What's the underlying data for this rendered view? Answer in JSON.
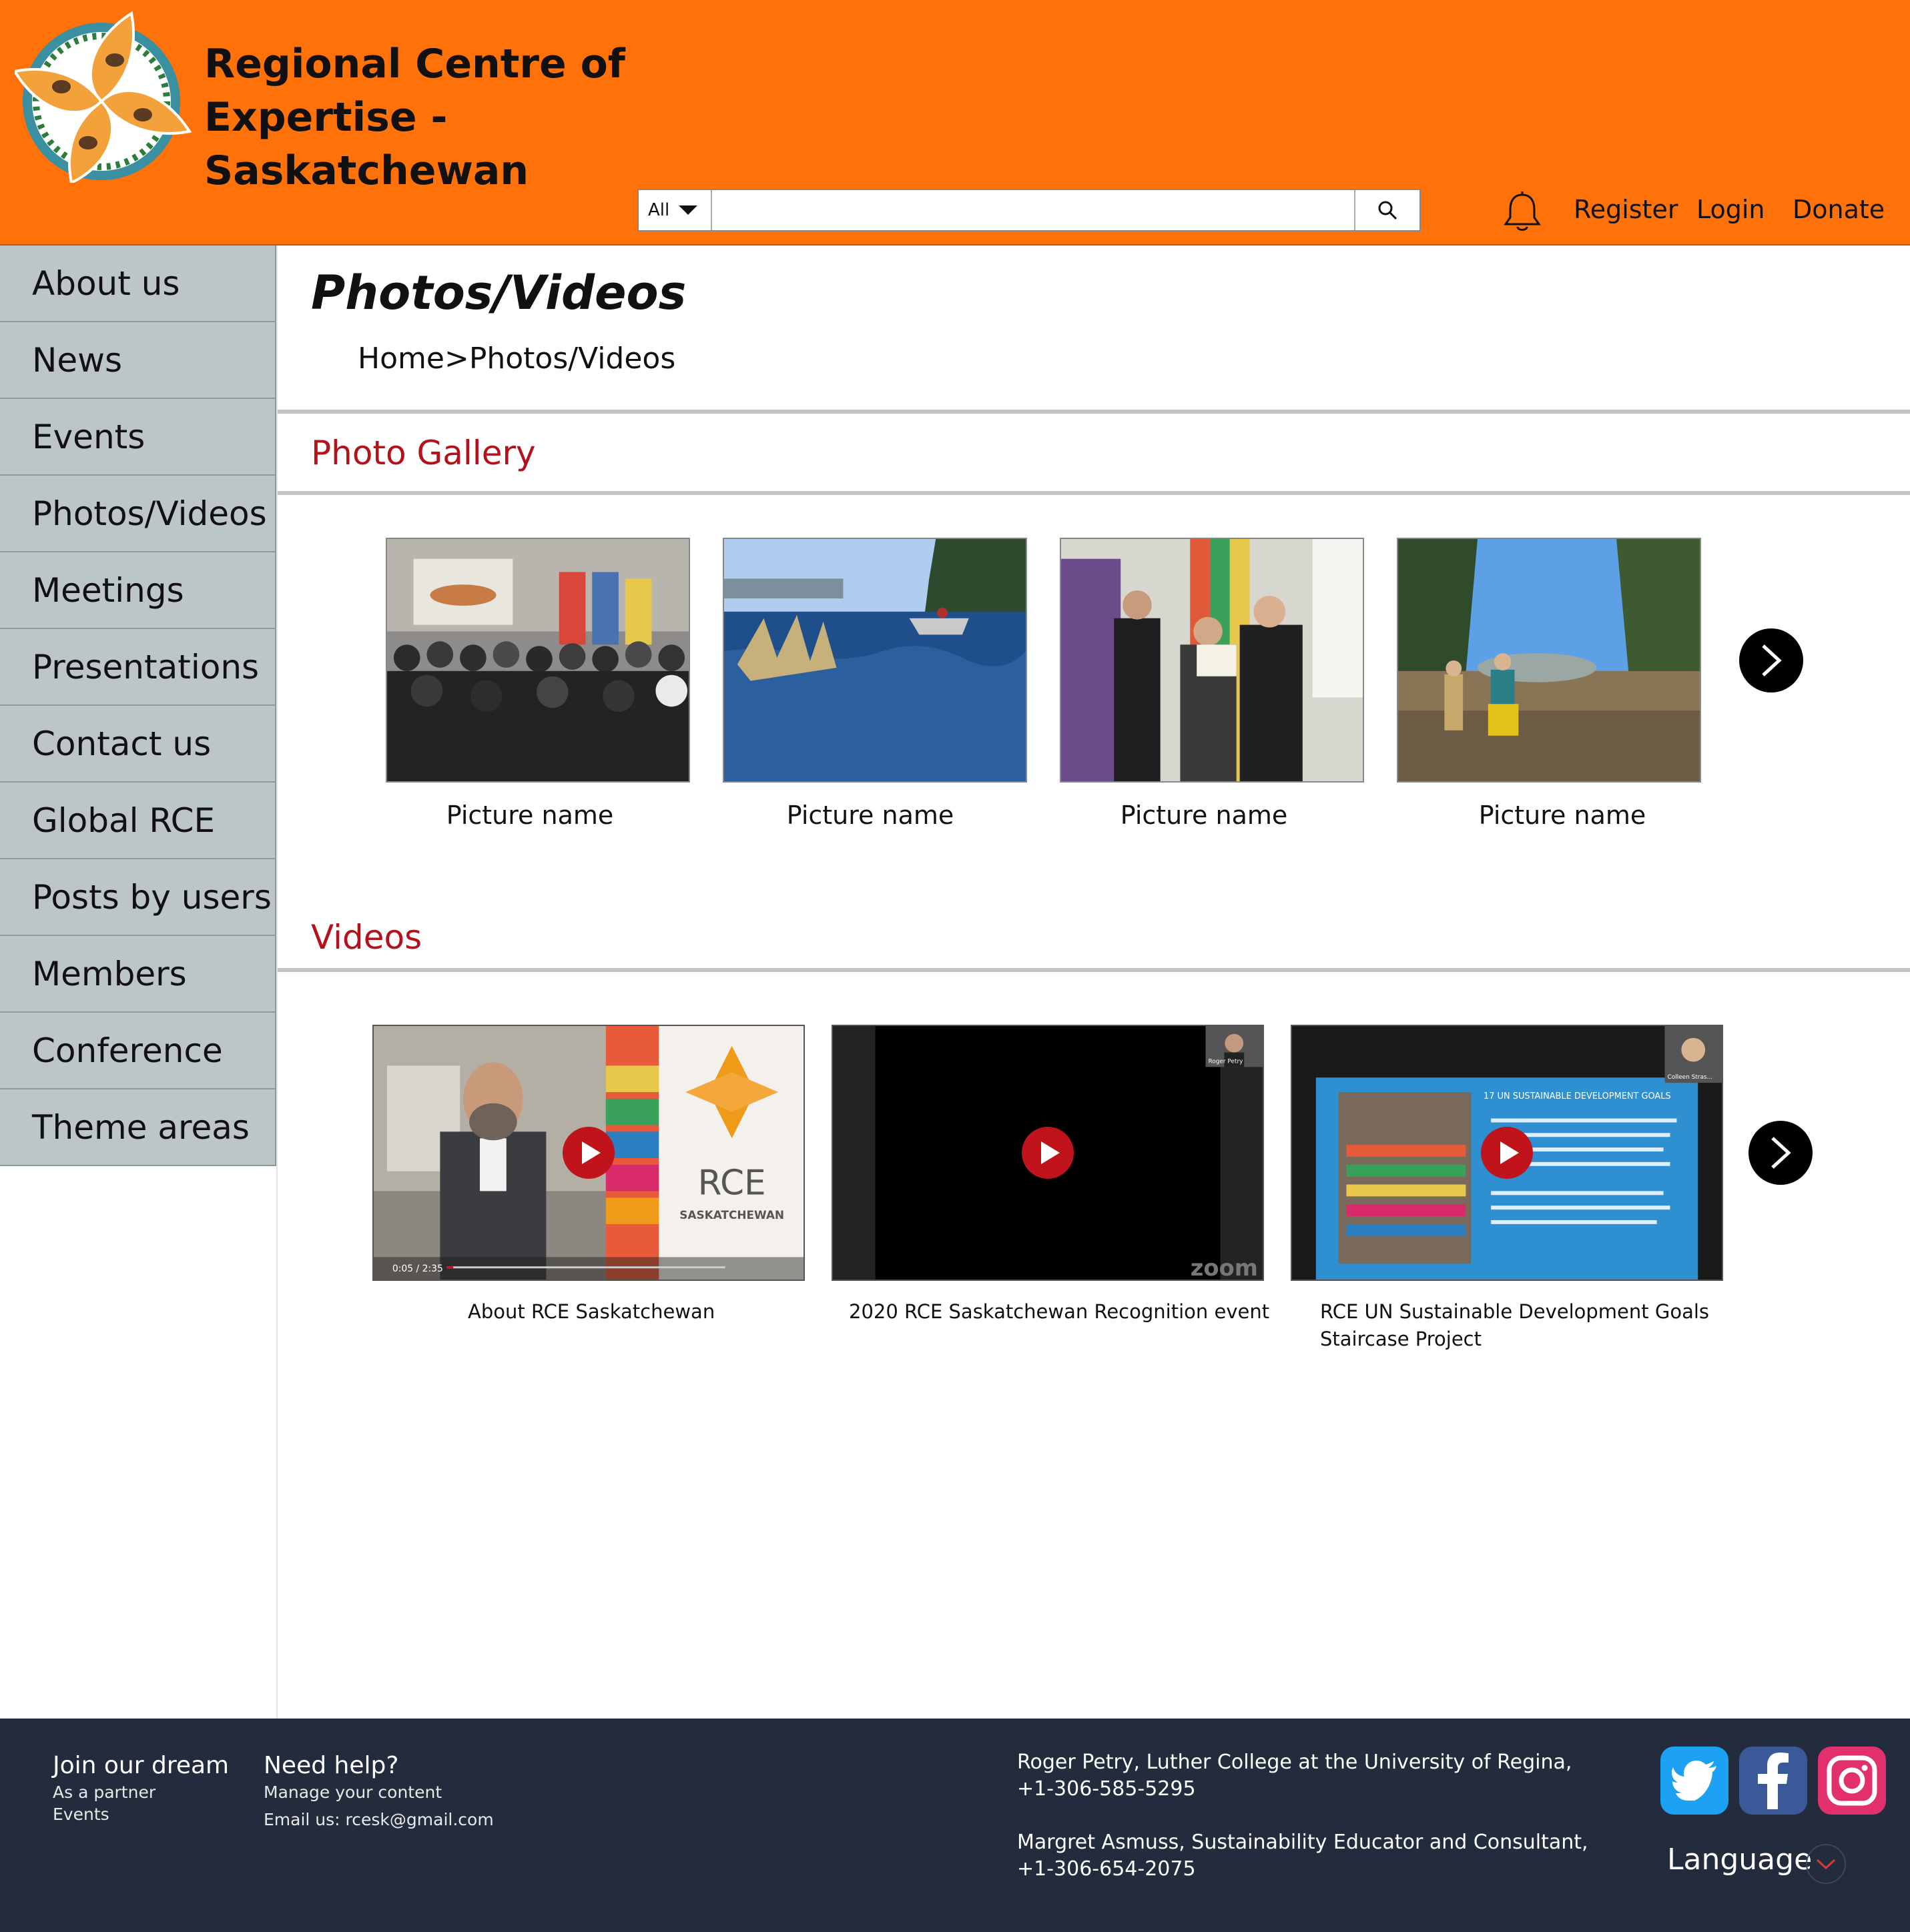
{
  "site": {
    "title_line1": "Regional Centre of Expertise -",
    "title_line2": "Saskatchewan"
  },
  "search": {
    "filter": "All",
    "placeholder": ""
  },
  "top_nav": {
    "register": "Register",
    "login": "Login",
    "donate": "Donate"
  },
  "sidebar": {
    "items": [
      {
        "label": "About us"
      },
      {
        "label": "News"
      },
      {
        "label": "Events"
      },
      {
        "label": "Photos/Videos"
      },
      {
        "label": "Meetings"
      },
      {
        "label": "Presentations"
      },
      {
        "label": "Contact us"
      },
      {
        "label": "Global RCE"
      },
      {
        "label": "Posts by users"
      },
      {
        "label": "Members"
      },
      {
        "label": "Conference"
      },
      {
        "label": "Theme areas"
      }
    ]
  },
  "main": {
    "page_title": "Photos/Videos",
    "breadcrumb": {
      "home": "Home",
      "separator": ">",
      "current": "Photos/Videos"
    }
  },
  "photo_gallery": {
    "title": "Photo Gallery",
    "photos": [
      {
        "caption": "Picture name"
      },
      {
        "caption": "Picture name"
      },
      {
        "caption": "Picture name"
      },
      {
        "caption": "Picture name"
      }
    ]
  },
  "videos": {
    "title": "Videos",
    "items": [
      {
        "caption": "About RCE Saskatchewan",
        "time": "0:05 / 2:35",
        "screen_text": "RCE",
        "screen_sub": "SASKATCHEWAN"
      },
      {
        "caption": "2020 RCE Saskatchewan Recognition event",
        "screen_text": "zoom",
        "participant": "Roger Petry"
      },
      {
        "caption_line1": "RCE UN Sustainable Development Goals",
        "caption_line2": "Staircase Project",
        "screen_text": "17 UN SUSTAINABLE DEVELOPMENT GOALS",
        "participant": "Colleen Stras..."
      }
    ]
  },
  "footer": {
    "join": {
      "heading": "Join our dream",
      "links": [
        "As a partner",
        "Events"
      ]
    },
    "help": {
      "heading": "Need help?",
      "links": [
        "Manage your content",
        "Email us: rcesk@gmail.com"
      ]
    },
    "contacts": [
      {
        "line1": "Roger Petry, Luther College at the University of Regina,",
        "line2": "+1-306-585-5295"
      },
      {
        "line1": "Margret Asmuss, Sustainability Educator and Consultant,",
        "line2": "+1-306-654-2075"
      }
    ],
    "language": "Language"
  },
  "colors": {
    "header": "#ff7209",
    "sidebar": "#bcc5c8",
    "section_title": "#b5111b",
    "footer": "#222c3c",
    "twitter": "#1da1f2",
    "facebook": "#3b5998"
  }
}
